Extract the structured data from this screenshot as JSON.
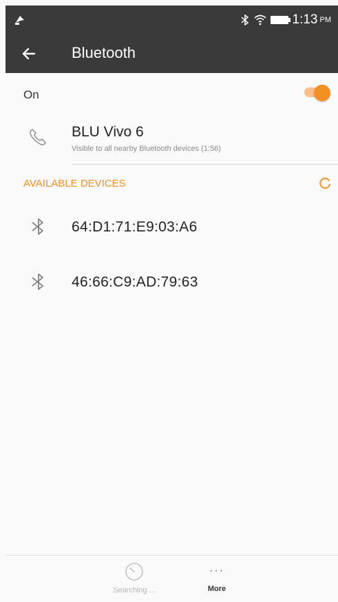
{
  "status_bar": {
    "time": "1:13",
    "ampm": "PM"
  },
  "app_bar": {
    "title": "Bluetooth"
  },
  "toggle": {
    "label": "On",
    "state": "on"
  },
  "this_device": {
    "name": "BLU Vivo 6",
    "subtitle": "Visible to all nearby Bluetooth devices (1:56)"
  },
  "available": {
    "header": "AVAILABLE DEVICES",
    "devices": [
      {
        "address": "64:D1:71:E9:03:A6"
      },
      {
        "address": "46:66:C9:AD:79:63"
      }
    ]
  },
  "bottom_bar": {
    "search_label": "Searching ...",
    "more_label": "More"
  },
  "colors": {
    "accent": "#f39023",
    "bar": "#3a3a3a"
  }
}
